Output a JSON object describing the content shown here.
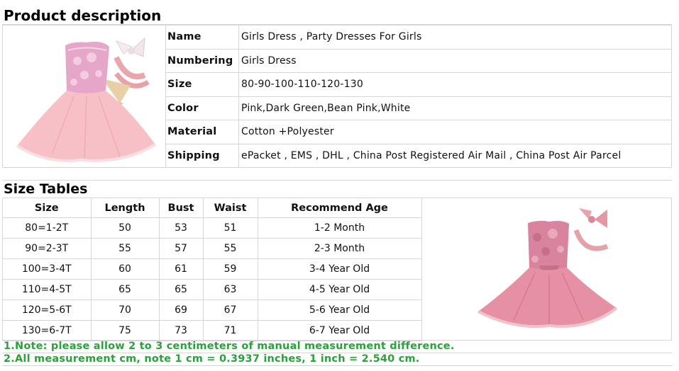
{
  "product_description": {
    "title": "Product description",
    "rows": [
      {
        "label": "Name",
        "value": "Girls Dress , Party Dresses For Girls"
      },
      {
        "label": "Numbering",
        "value": "Girls Dress"
      },
      {
        "label": "Size",
        "value": "80-90-100-110-120-130"
      },
      {
        "label": "Color",
        "value": "Pink,Dark Green,Bean Pink,White"
      },
      {
        "label": "Material",
        "value": "Cotton +Polyester"
      },
      {
        "label": "Shipping",
        "value": "ePacket , EMS , DHL , China Post Registered Air Mail , China Post Air Parcel"
      }
    ]
  },
  "size_tables": {
    "title": "Size Tables",
    "headers": [
      "Size",
      "Length",
      "Bust",
      "Waist",
      "Recommend Age"
    ],
    "rows": [
      [
        "80=1-2T",
        "50",
        "53",
        "51",
        "1-2 Month"
      ],
      [
        "90=2-3T",
        "55",
        "57",
        "55",
        "2-3 Month"
      ],
      [
        "100=3-4T",
        "60",
        "61",
        "59",
        "3-4 Year Old"
      ],
      [
        "110=4-5T",
        "65",
        "65",
        "63",
        "4-5 Year Old"
      ],
      [
        "120=5-6T",
        "70",
        "69",
        "67",
        "5-6 Year Old"
      ],
      [
        "130=6-7T",
        "75",
        "73",
        "71",
        "6-7 Year Old"
      ]
    ]
  },
  "notes": {
    "note1": "1.Note: please allow 2 to 3 centimeters of manual measurement difference.",
    "note2": "2.All measurement cm, note 1 cm = 0.3937 inches, 1 inch = 2.540 cm."
  },
  "colors": {
    "note_green": "#2aa13a",
    "dress_pink": "#f4b6c0",
    "bodice_pink": "#e8a8c8",
    "border": "#d6d6d6"
  }
}
